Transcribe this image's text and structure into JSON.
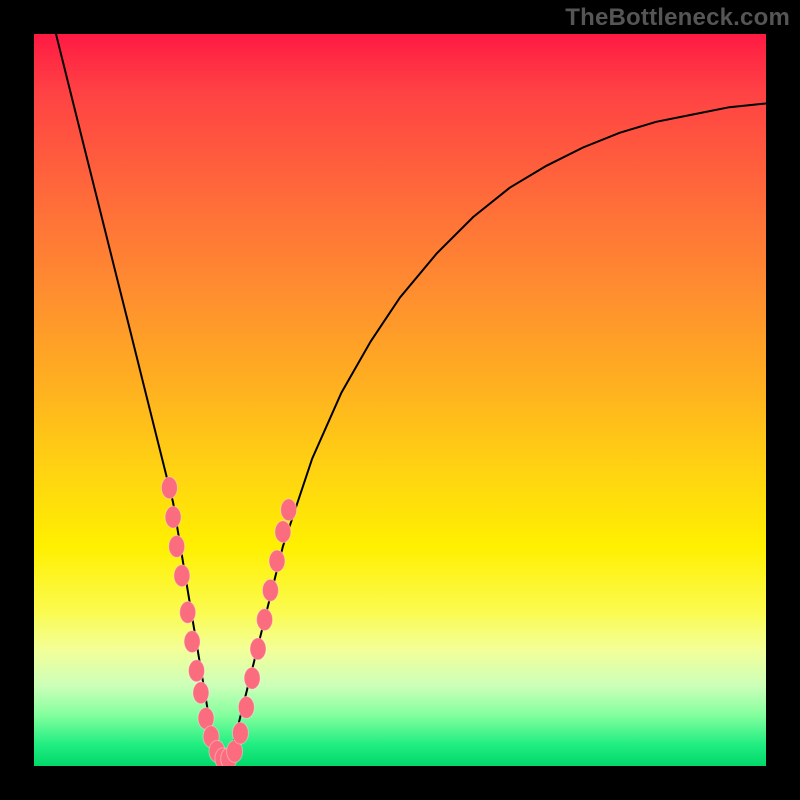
{
  "watermark": "TheBottleneck.com",
  "chart_data": {
    "type": "line",
    "title": "",
    "xlabel": "",
    "ylabel": "",
    "xlim": [
      0,
      100
    ],
    "ylim": [
      0,
      100
    ],
    "legend": false,
    "grid": false,
    "background_gradient": [
      "#ff1a43",
      "#ffd411",
      "#02d86a"
    ],
    "series": [
      {
        "name": "bottleneck-curve",
        "x": [
          3,
          5,
          7,
          9,
          11,
          13,
          15,
          17,
          19,
          21,
          22,
          23,
          24,
          25,
          26,
          27,
          28,
          30,
          32,
          34,
          38,
          42,
          46,
          50,
          55,
          60,
          65,
          70,
          75,
          80,
          85,
          90,
          95,
          100
        ],
        "y": [
          100,
          92,
          84,
          76,
          68,
          60,
          52,
          44,
          36,
          24,
          18,
          12,
          6,
          2,
          0,
          2,
          6,
          14,
          22,
          30,
          42,
          51,
          58,
          64,
          70,
          75,
          79,
          82,
          84.5,
          86.5,
          88,
          89,
          90,
          90.5
        ]
      }
    ],
    "scatter_overlay": {
      "name": "sample-points",
      "points": [
        {
          "x": 18.5,
          "y": 38
        },
        {
          "x": 19.0,
          "y": 34
        },
        {
          "x": 19.5,
          "y": 30
        },
        {
          "x": 20.2,
          "y": 26
        },
        {
          "x": 21.0,
          "y": 21
        },
        {
          "x": 21.6,
          "y": 17
        },
        {
          "x": 22.2,
          "y": 13
        },
        {
          "x": 22.8,
          "y": 10
        },
        {
          "x": 23.5,
          "y": 6.5
        },
        {
          "x": 24.2,
          "y": 4
        },
        {
          "x": 25.0,
          "y": 2
        },
        {
          "x": 25.8,
          "y": 1
        },
        {
          "x": 26.6,
          "y": 1
        },
        {
          "x": 27.4,
          "y": 2
        },
        {
          "x": 28.2,
          "y": 4.5
        },
        {
          "x": 29.0,
          "y": 8
        },
        {
          "x": 29.8,
          "y": 12
        },
        {
          "x": 30.6,
          "y": 16
        },
        {
          "x": 31.5,
          "y": 20
        },
        {
          "x": 32.3,
          "y": 24
        },
        {
          "x": 33.2,
          "y": 28
        },
        {
          "x": 34.0,
          "y": 32
        },
        {
          "x": 34.8,
          "y": 35
        }
      ]
    }
  }
}
